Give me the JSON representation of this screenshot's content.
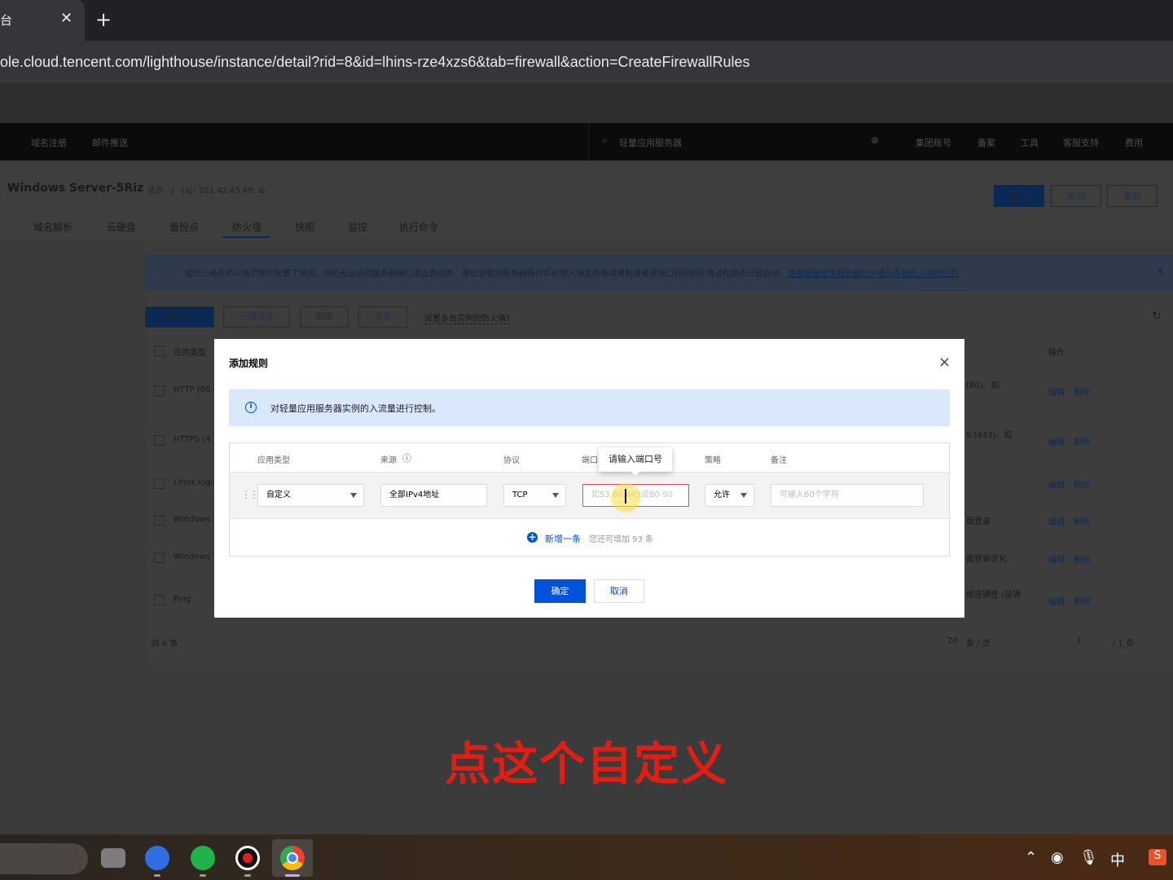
{
  "browser": {
    "tab_title": "台",
    "tab_close": "✕",
    "new_tab": "+",
    "url": "ole.cloud.tencent.com/lighthouse/instance/detail?rid=8&id=lhins-rze4xzs6&tab=firewall&action=CreateFirewallRules"
  },
  "topnav": {
    "items_left": [
      "域名注册",
      "邮件推送"
    ],
    "search_placeholder": "轻量应用服务器",
    "items_right": [
      "集团账号",
      "备案",
      "工具",
      "客服支持",
      "费用"
    ]
  },
  "instance": {
    "title": "Windows Server-5Riz",
    "region": "北京",
    "ip": "(公) 101.42.43.48",
    "buttons": [
      "登录",
      "关机",
      "重启"
    ]
  },
  "page_tabs": [
    "域名解析",
    "云硬盘",
    "备份点",
    "防火墙",
    "快照",
    "监控",
    "执行命令"
  ],
  "notice": {
    "text": "如您已经在防火墙页面中配置了规则，但仍无法访问服务器端口或业务应用，建议您检测服务器操作系统防火墙是否有做限制或者该端口对应的应用进程是否已经启动。",
    "link": "查看轻量应用服务器防火墙与系统防火墙的区别"
  },
  "toolbar": {
    "add_rule": "添加规则",
    "one_click": "一键放通",
    "delete": "删除",
    "sort": "排序",
    "multi_link": "设置多台实例的防火墙?"
  },
  "bg_table": {
    "header_app": "应用类型",
    "header_op": "操作",
    "rows": [
      {
        "app": "HTTP (80",
        "remark": "(80)。如"
      },
      {
        "app": "HTTPS (4",
        "remark": "S (443)。如"
      },
      {
        "app": "Linux logi",
        "remark": ""
      },
      {
        "app": "Windows",
        "remark": "面登录"
      },
      {
        "app": "Windows",
        "remark": "面登录优化"
      },
      {
        "app": "Ping",
        "remark": "络连通性 (放通"
      }
    ],
    "edit": "编辑",
    "del": "删除"
  },
  "pagination": {
    "total": "共 6 条",
    "page_size": "20",
    "per_page": "条 / 页",
    "page": "1",
    "of_pages": "/ 1 页"
  },
  "modal": {
    "title": "添加规则",
    "close": "×",
    "info": "对轻量应用服务器实例的入流量进行控制。",
    "columns": {
      "app_type": "应用类型",
      "source": "来源",
      "protocol": "协议",
      "port": "端口",
      "policy": "策略",
      "remark": "备注"
    },
    "row": {
      "app_type": "自定义",
      "source": "全部IPv4地址",
      "protocol": "TCP",
      "port_placeholder": "如53,80,443或80-90",
      "policy": "允许",
      "remark_placeholder": "可输入60个字符"
    },
    "tooltip": "请输入端口号",
    "add_label": "新增一条",
    "add_hint": "您还可增加 93 条",
    "ok": "确定",
    "cancel": "取消"
  },
  "caption": "点这个自定义",
  "taskbar": {
    "tray_ime": "中"
  },
  "colors": {
    "primary": "#0052d9",
    "error": "#e34d59",
    "caption": "#e01e14"
  }
}
